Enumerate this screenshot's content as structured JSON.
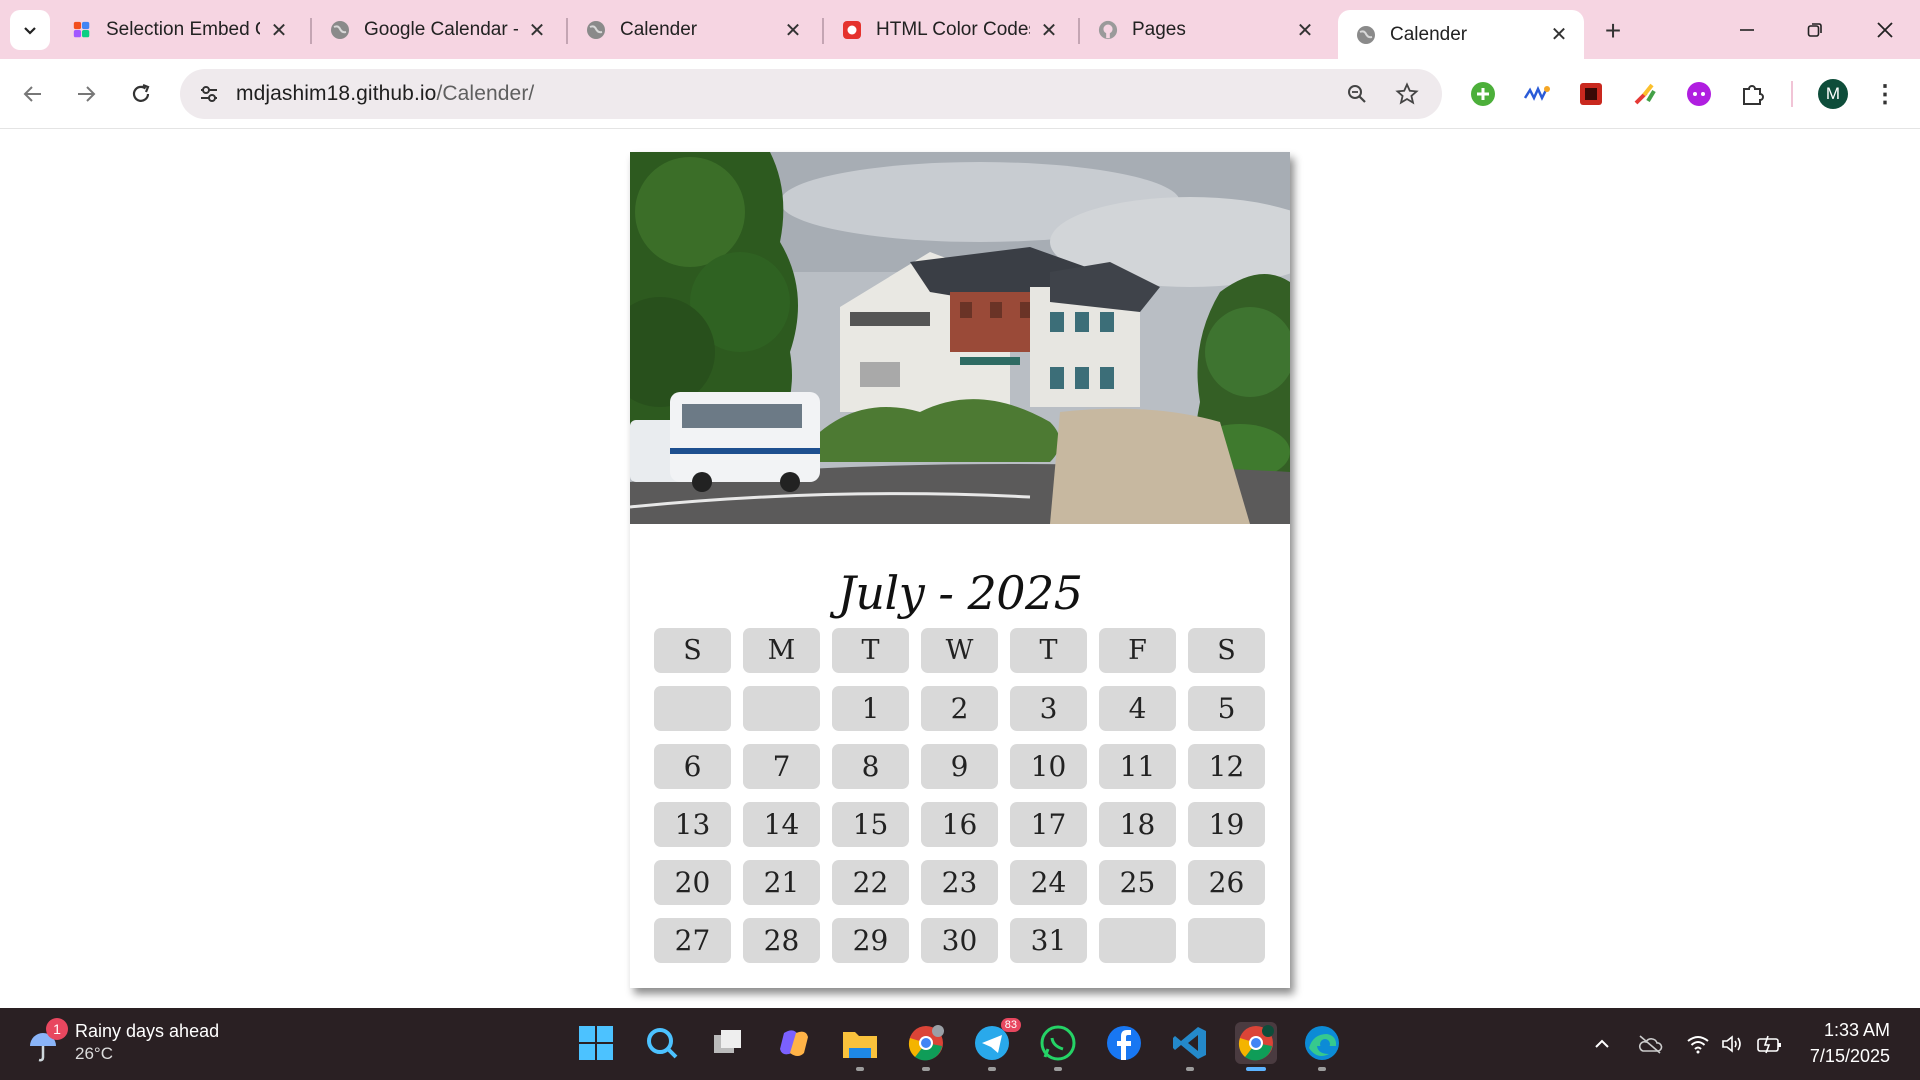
{
  "browser": {
    "tabs": [
      {
        "title": "Selection Embed C",
        "favicon": "figma-multicolor-icon"
      },
      {
        "title": "Google Calendar -",
        "favicon": "globe-icon"
      },
      {
        "title": "Calender",
        "favicon": "globe-icon"
      },
      {
        "title": "HTML Color Codes",
        "favicon": "color-codes-icon"
      },
      {
        "title": "Pages",
        "favicon": "github-icon"
      },
      {
        "title": "Calender",
        "favicon": "globe-icon",
        "active": true
      }
    ],
    "url_host": "mdjashim18.github.io",
    "url_path": "/Calender/",
    "profile_initial": "M"
  },
  "calendar": {
    "title": "July - 2025",
    "weekdays": [
      "S",
      "M",
      "T",
      "W",
      "T",
      "F",
      "S"
    ],
    "days": [
      "",
      "",
      "1",
      "2",
      "3",
      "4",
      "5",
      "6",
      "7",
      "8",
      "9",
      "10",
      "11",
      "12",
      "13",
      "14",
      "15",
      "16",
      "17",
      "18",
      "19",
      "20",
      "21",
      "22",
      "23",
      "24",
      "25",
      "26",
      "27",
      "28",
      "29",
      "30",
      "31",
      "",
      ""
    ]
  },
  "taskbar": {
    "weather_badge": "1",
    "weather_title": "Rainy days ahead",
    "weather_temp": "26°C",
    "telegram_badge": "83",
    "time": "1:33 AM",
    "date": "7/15/2025"
  },
  "colors": {
    "tabstrip": "#f6d5e2",
    "taskbar": "#2a2023",
    "calendar_cell": "#d9d9d9"
  }
}
